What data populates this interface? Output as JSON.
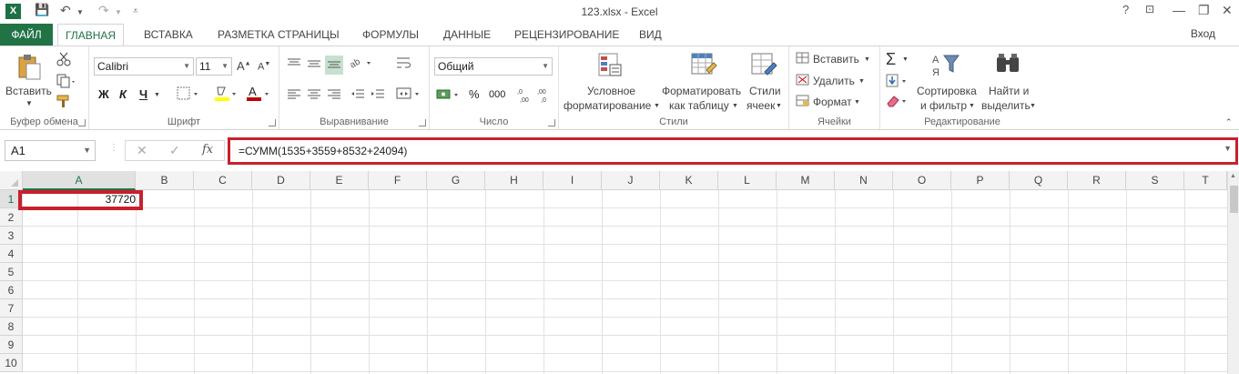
{
  "window": {
    "title": "123.xlsx - Excel",
    "help": "?",
    "buttons": [
      "—",
      "❐",
      "✕"
    ]
  },
  "qat": {
    "undo": "↶",
    "redo": "↷"
  },
  "tabs": {
    "file": "ФАЙЛ",
    "items": [
      "ГЛАВНАЯ",
      "ВСТАВКА",
      "РАЗМЕТКА СТРАНИЦЫ",
      "ФОРМУЛЫ",
      "ДАННЫЕ",
      "РЕЦЕНЗИРОВАНИЕ",
      "ВИД"
    ],
    "active": "ГЛАВНАЯ",
    "signin": "Вход"
  },
  "ribbon": {
    "clipboard": {
      "label": "Буфер обмена",
      "paste": "Вставить"
    },
    "font": {
      "label": "Шрифт",
      "name": "Calibri",
      "size": "11",
      "bold": "Ж",
      "italic": "К",
      "underline": "Ч"
    },
    "alignment": {
      "label": "Выравнивание"
    },
    "number": {
      "label": "Число",
      "format": "Общий",
      "percent": "%",
      "thousands": "000"
    },
    "styles": {
      "label": "Стили",
      "conditional_1": "Условное",
      "conditional_2": "форматирование",
      "table_1": "Форматировать",
      "table_2": "как таблицу",
      "cell_1": "Стили",
      "cell_2": "ячеек"
    },
    "cells": {
      "label": "Ячейки",
      "insert": "Вставить",
      "delete": "Удалить",
      "format": "Формат"
    },
    "editing": {
      "label": "Редактирование",
      "sort_1": "Сортировка",
      "sort_2": "и фильтр",
      "find_1": "Найти и",
      "find_2": "выделить"
    }
  },
  "formula_bar": {
    "name_box": "A1",
    "cancel": "✕",
    "enter": "✓",
    "fx": "fx",
    "formula": "=СУММ(1535+3559+8532+24094)"
  },
  "sheet": {
    "columns": [
      "A",
      "B",
      "C",
      "D",
      "E",
      "F",
      "G",
      "H",
      "I",
      "J",
      "K",
      "L",
      "M",
      "N",
      "O",
      "P",
      "Q",
      "R",
      "S",
      "T"
    ],
    "rows": [
      "1",
      "2",
      "3",
      "4",
      "5",
      "6",
      "7",
      "8",
      "9",
      "10"
    ],
    "selected_cell": "A1",
    "a1_value": "37720"
  },
  "colors": {
    "excel_green": "#217346",
    "highlight_red": "#c8202c"
  }
}
